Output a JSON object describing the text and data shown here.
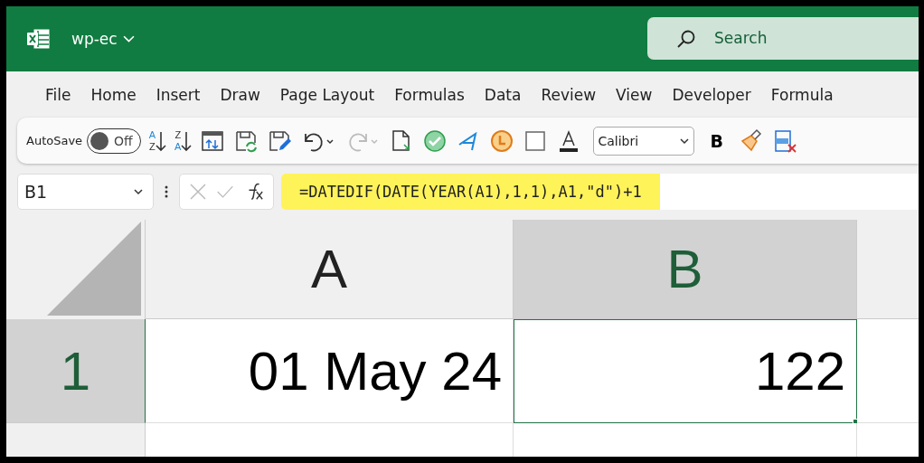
{
  "app": {
    "title": "wp-ec",
    "search": {
      "placeholder": "Search"
    }
  },
  "menu": [
    "File",
    "Home",
    "Insert",
    "Draw",
    "Page Layout",
    "Formulas",
    "Data",
    "Review",
    "View",
    "Developer",
    "Formula"
  ],
  "toolbar": {
    "autosave": {
      "label": "AutoSave",
      "on": false,
      "state": "Off"
    },
    "sort_ascending": {
      "top": "A",
      "bottom": "Z"
    },
    "sort_descending": {
      "top": "Z",
      "bottom": "A"
    },
    "font": "Calibri",
    "bold": "B"
  },
  "formula_bar": {
    "name_box": "B1",
    "formula": "=DATEDIF(DATE(YEAR(A1),1,1),A1,\"d\")+1"
  },
  "columns": [
    {
      "label": "A",
      "selected": false
    },
    {
      "label": "B",
      "selected": true
    }
  ],
  "rows": [
    {
      "label": "1",
      "selected": true,
      "cells": [
        {
          "value": "01 May 24",
          "selected": false
        },
        {
          "value": "122",
          "selected": true
        }
      ]
    }
  ]
}
